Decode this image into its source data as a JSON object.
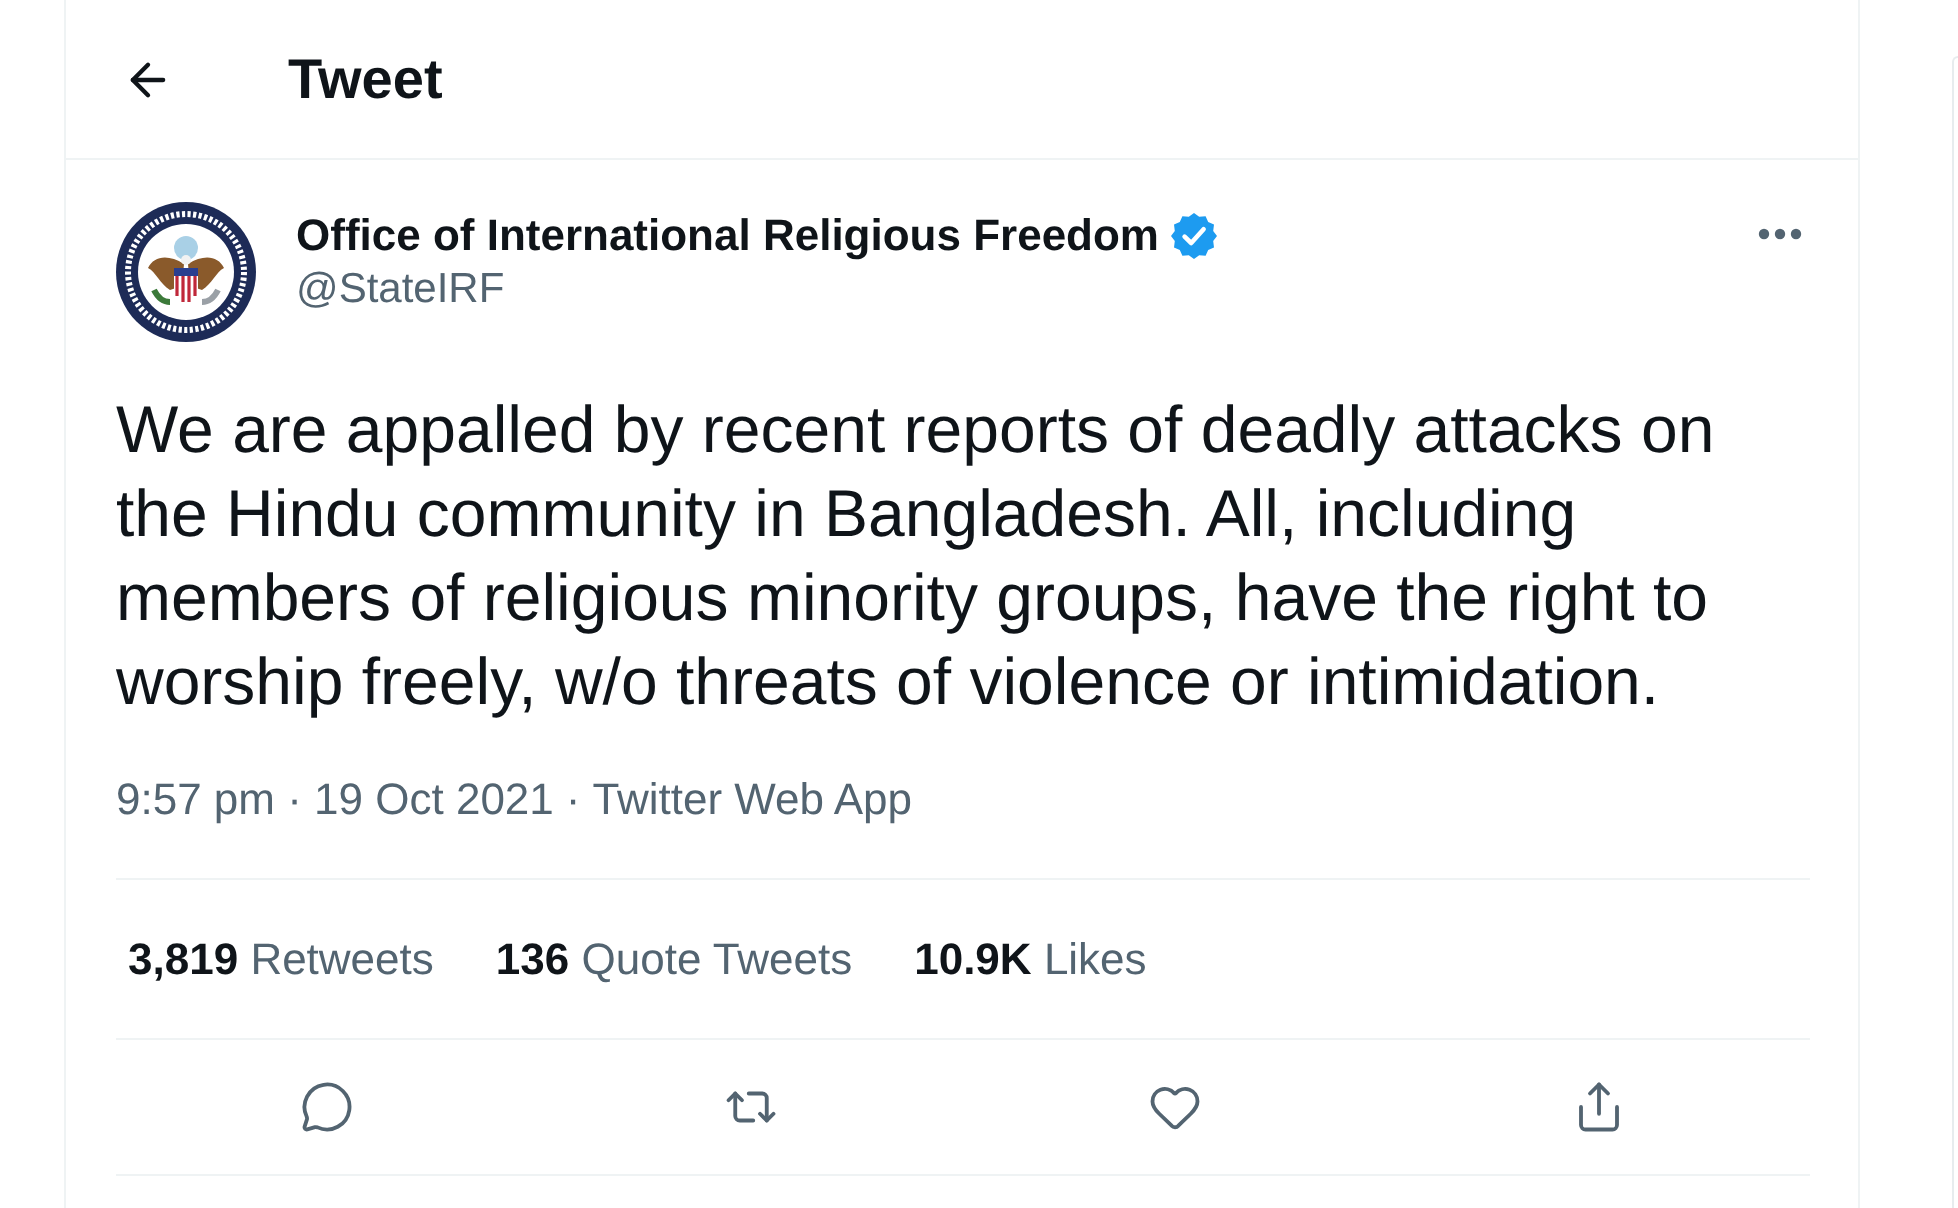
{
  "header": {
    "title": "Tweet"
  },
  "tweet": {
    "author": {
      "name": "Office of International Religious Freedom",
      "verified": true,
      "handle": "@StateIRF"
    },
    "text": "We are appalled by recent reports of deadly attacks on the Hindu community in Bangladesh. All, including members of religious minority groups, have the right to worship freely, w/o threats of violence or intimidation.",
    "timestamp": "9:57 pm · 19 Oct 2021",
    "separator": "·",
    "source": "Twitter Web App",
    "stats": [
      {
        "count": "3,819",
        "label": "Retweets"
      },
      {
        "count": "136",
        "label": "Quote Tweets"
      },
      {
        "count": "10.9K",
        "label": "Likes"
      }
    ],
    "actions": [
      {
        "kind": "reply"
      },
      {
        "kind": "retweet"
      },
      {
        "kind": "like"
      },
      {
        "kind": "share"
      }
    ]
  }
}
